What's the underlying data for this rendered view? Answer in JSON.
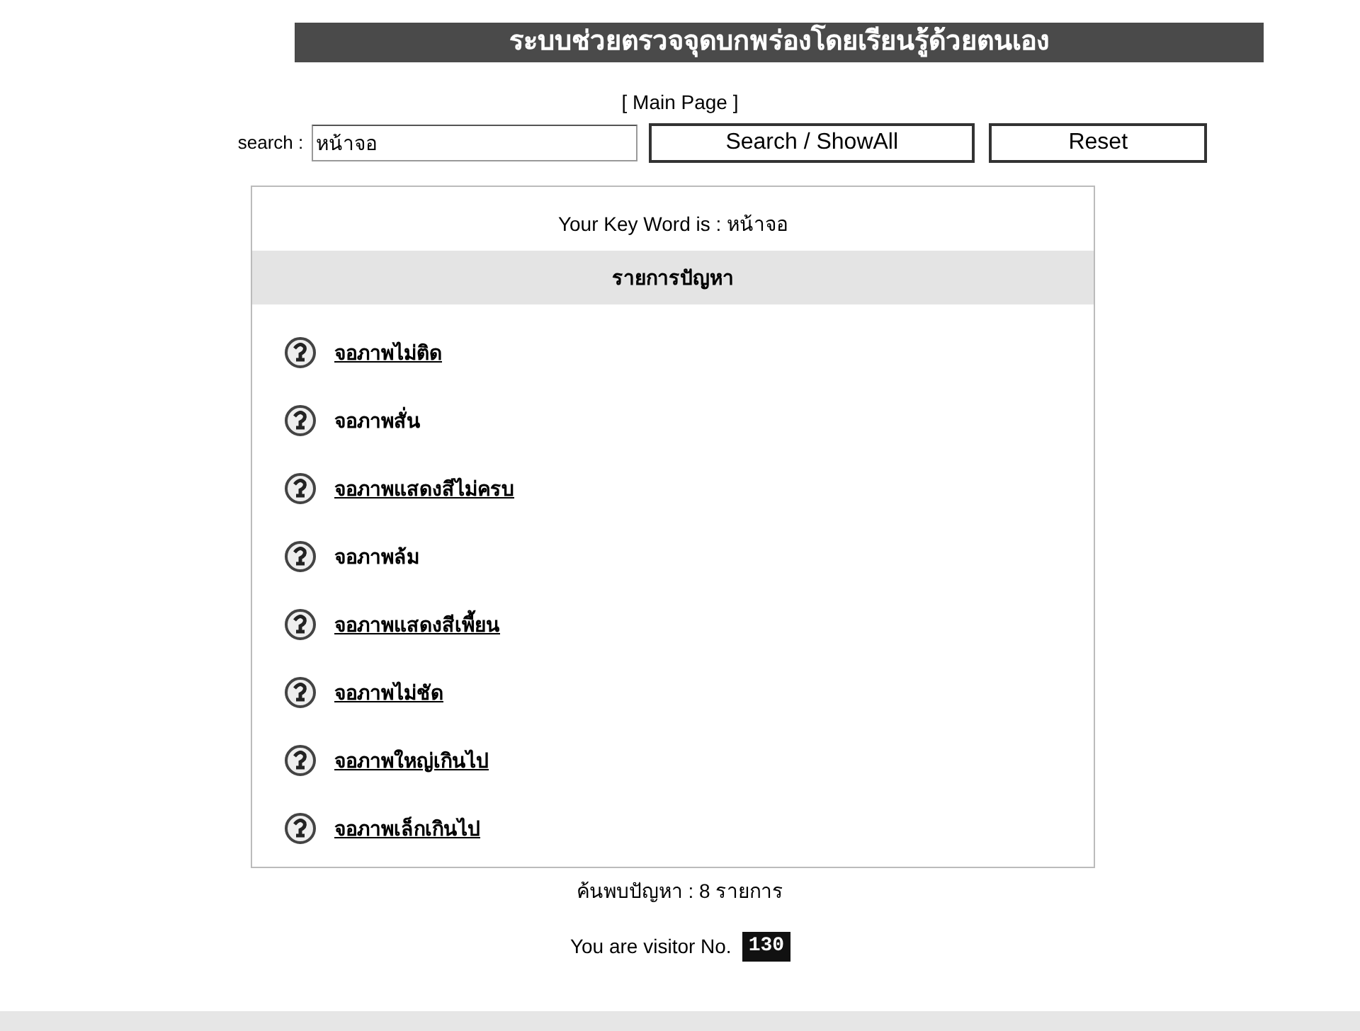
{
  "title": "ระบบช่วยตรวจจุดบกพร่องโดยเรียนรู้ด้วยตนเอง",
  "main_link": "[ Main Page ]",
  "search": {
    "label": "search :",
    "value": "หน้าจอ"
  },
  "buttons": [
    "Search / ShowAll",
    "Reset"
  ],
  "keyword_line": "Your Key Word is : หน้าจอ",
  "list_header": "รายการปัญหา",
  "problems": [
    {
      "text": "จอภาพไม่ติด",
      "linked": true
    },
    {
      "text": "จอภาพสั่น",
      "linked": false
    },
    {
      "text": "จอภาพแสดงสีไม่ครบ",
      "linked": true
    },
    {
      "text": "จอภาพล้ม",
      "linked": false
    },
    {
      "text": "จอภาพแสดงสีเพี้ยน",
      "linked": true
    },
    {
      "text": "จอภาพไม่ชัด",
      "linked": true
    },
    {
      "text": "จอภาพใหญ่เกินไป",
      "linked": true
    },
    {
      "text": "จอภาพเล็กเกินไป",
      "linked": true
    }
  ],
  "found_count": "ค้นพบปัญหา : 8 รายการ",
  "visitor": {
    "label": "You are visitor No.",
    "counter": "130"
  }
}
